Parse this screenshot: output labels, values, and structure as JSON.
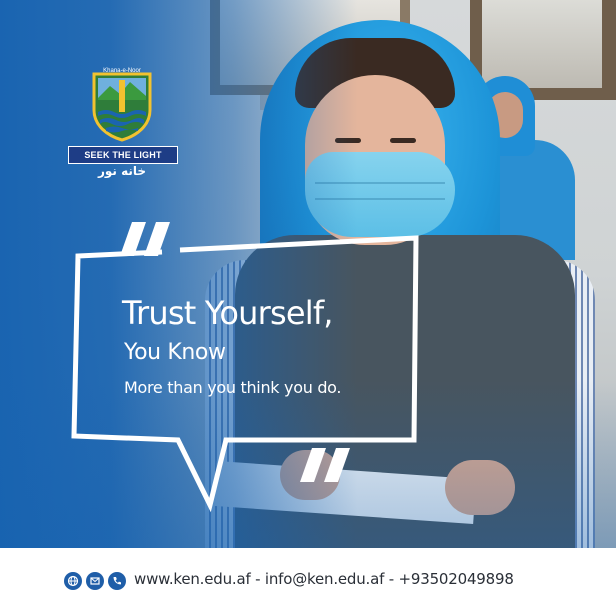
{
  "logo": {
    "top_text": "Khana-e-Noor",
    "tagline": "SEEK THE LIGHT",
    "urdu": "خانه نور"
  },
  "quote": {
    "line1": "Trust Yourself,",
    "line2": "You Know",
    "line3": "More than you think you do."
  },
  "footer": {
    "contact": "www.ken.edu.af - info@ken.edu.af - +93502049898",
    "icons": [
      "globe-icon",
      "email-icon",
      "phone-icon"
    ]
  },
  "colors": {
    "brand_blue": "#1662b0",
    "navy": "#1e3d86",
    "white": "#ffffff"
  }
}
